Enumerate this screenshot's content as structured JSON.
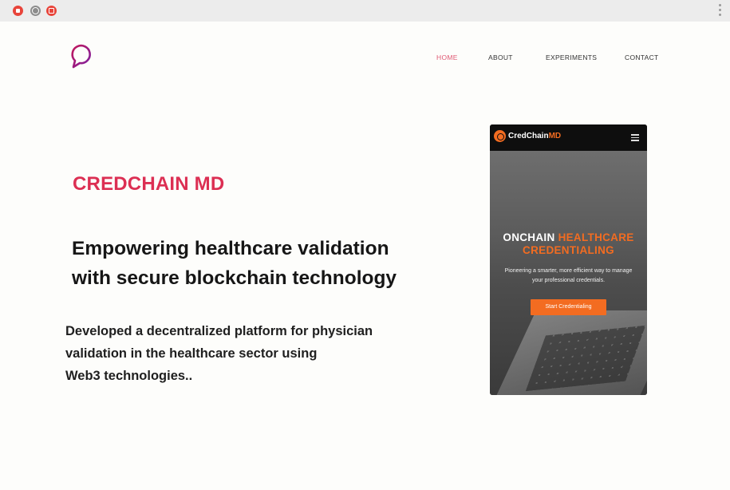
{
  "nav": {
    "home": "HOME",
    "about": "ABOUT",
    "experiments": "EXPERIMENTS",
    "contact": "CONTACT"
  },
  "hero": {
    "eyebrow": "CREDCHAIN MD",
    "headline_line1": "Empowering healthcare validation",
    "headline_line2": "with secure blockchain technology",
    "body_line1": "Developed a decentralized platform  for physician",
    "body_line2": "validation in the healthcare sector using",
    "body_line3": "Web3 technologies.."
  },
  "phone": {
    "brand_main": "CredChain",
    "brand_accent": "MD",
    "title_white": "ONCHAIN",
    "title_orange_1": "HEALTHCARE",
    "title_orange_2": "CREDENTIALING",
    "subtitle_line1": "Pioneering a smarter, more efficient way to manage",
    "subtitle_line2": "your professional credentials.",
    "cta": "Start Credentialing"
  },
  "colors": {
    "accent_pink": "#dc2f53",
    "nav_active": "#e05a74",
    "phone_orange": "#f36c21"
  },
  "icons": [
    "record-icon",
    "globe-icon",
    "extension-icon",
    "kebab-menu-icon",
    "logo-icon",
    "hamburger-menu-icon"
  ]
}
